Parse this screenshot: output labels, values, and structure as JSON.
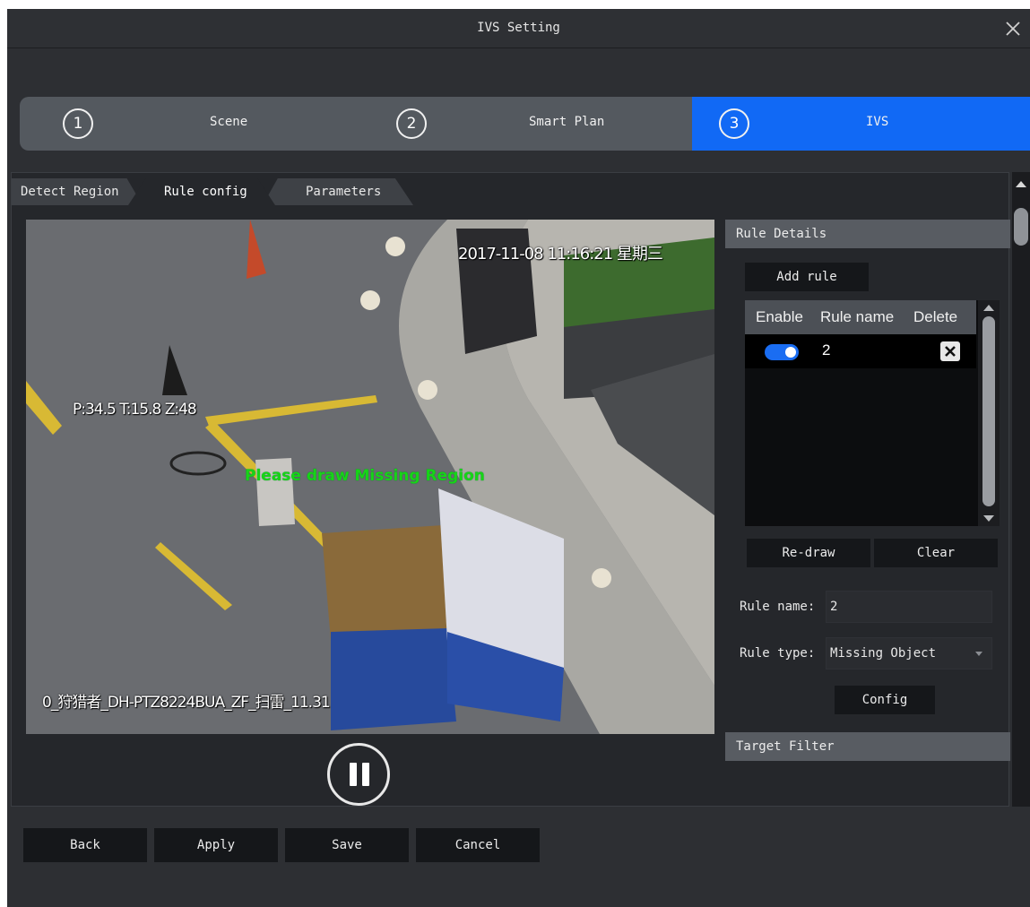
{
  "window": {
    "title": "IVS Setting"
  },
  "stepper": {
    "steps": [
      {
        "num": "1",
        "label": "Scene"
      },
      {
        "num": "2",
        "label": "Smart Plan"
      },
      {
        "num": "3",
        "label": "IVS"
      }
    ],
    "active_color": "#1169f5"
  },
  "tabs": [
    "Detect Region",
    "Rule config",
    "Parameters"
  ],
  "video": {
    "timestamp": "2017-11-08 11:16:21 星期三",
    "ptz": "P:34.5 T:15.8 Z:48",
    "camera_name": "0_狩猎者_DH-PTZ8224BUA_ZF_扫雷_11.31",
    "prompt": "Please draw Missing Region"
  },
  "rule_details": {
    "header": "Rule Details",
    "add_rule": "Add rule",
    "table": {
      "columns": [
        "Enable",
        "Rule name",
        "Delete"
      ],
      "rows": [
        {
          "enabled": true,
          "name": "2"
        }
      ]
    },
    "redraw": "Re-draw",
    "clear": "Clear",
    "rule_name_label": "Rule name:",
    "rule_name_value": "2",
    "rule_type_label": "Rule type:",
    "rule_type_value": "Missing Object",
    "config": "Config"
  },
  "target_filter": {
    "header": "Target Filter"
  },
  "footer": {
    "back": "Back",
    "apply": "Apply",
    "save": "Save",
    "cancel": "Cancel"
  }
}
